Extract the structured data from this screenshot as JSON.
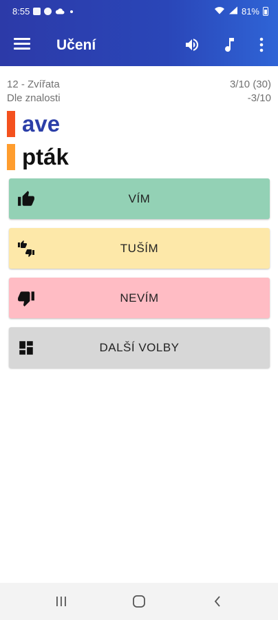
{
  "status_bar": {
    "time": "8:55",
    "battery": "81%",
    "icons": [
      "gallery-icon",
      "messenger-icon",
      "cloud-icon",
      "wifi-icon",
      "signal-icon",
      "battery-icon"
    ]
  },
  "app_bar": {
    "title": "Učení",
    "actions": [
      "menu-icon",
      "volume-icon",
      "music-note-icon",
      "more-vert-icon"
    ]
  },
  "lesson": {
    "category": "12 - Zvířata",
    "mode": "Dle znalosti",
    "progress": "3/10 (30)",
    "score": "-3/10"
  },
  "words": {
    "foreign": "ave",
    "foreign_color": "#2c3fa8",
    "foreign_marker_color": "#f4511e",
    "native": "pták",
    "native_color": "#111111",
    "native_marker_color": "#ff9d2e"
  },
  "buttons": {
    "know": {
      "label": "VÍM",
      "color": "#93d1b5",
      "icon": "thumb-up-icon"
    },
    "guess": {
      "label": "TUŠÍM",
      "color": "#fde8a9",
      "icon": "thumbs-mixed-icon"
    },
    "dont_know": {
      "label": "NEVÍM",
      "color": "#ffbcc4",
      "icon": "thumb-down-icon"
    },
    "more": {
      "label": "DALŠÍ VOLBY",
      "color": "#d7d7d7",
      "icon": "dashboard-icon"
    }
  },
  "nav_bar": [
    "recents-icon",
    "home-icon",
    "back-icon"
  ]
}
